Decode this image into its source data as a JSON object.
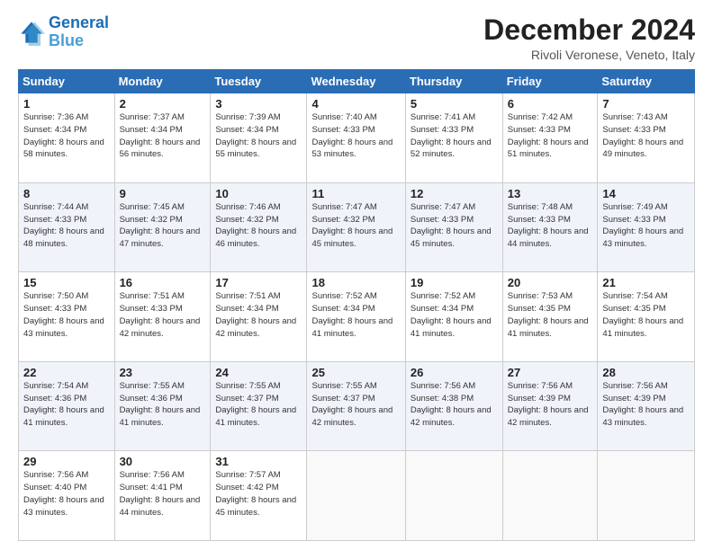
{
  "header": {
    "logo_line1": "General",
    "logo_line2": "Blue",
    "month": "December 2024",
    "location": "Rivoli Veronese, Veneto, Italy"
  },
  "days_of_week": [
    "Sunday",
    "Monday",
    "Tuesday",
    "Wednesday",
    "Thursday",
    "Friday",
    "Saturday"
  ],
  "weeks": [
    [
      {
        "day": "1",
        "sunrise": "7:36 AM",
        "sunset": "4:34 PM",
        "daylight": "8 hours and 58 minutes."
      },
      {
        "day": "2",
        "sunrise": "7:37 AM",
        "sunset": "4:34 PM",
        "daylight": "8 hours and 56 minutes."
      },
      {
        "day": "3",
        "sunrise": "7:39 AM",
        "sunset": "4:34 PM",
        "daylight": "8 hours and 55 minutes."
      },
      {
        "day": "4",
        "sunrise": "7:40 AM",
        "sunset": "4:33 PM",
        "daylight": "8 hours and 53 minutes."
      },
      {
        "day": "5",
        "sunrise": "7:41 AM",
        "sunset": "4:33 PM",
        "daylight": "8 hours and 52 minutes."
      },
      {
        "day": "6",
        "sunrise": "7:42 AM",
        "sunset": "4:33 PM",
        "daylight": "8 hours and 51 minutes."
      },
      {
        "day": "7",
        "sunrise": "7:43 AM",
        "sunset": "4:33 PM",
        "daylight": "8 hours and 49 minutes."
      }
    ],
    [
      {
        "day": "8",
        "sunrise": "7:44 AM",
        "sunset": "4:33 PM",
        "daylight": "8 hours and 48 minutes."
      },
      {
        "day": "9",
        "sunrise": "7:45 AM",
        "sunset": "4:32 PM",
        "daylight": "8 hours and 47 minutes."
      },
      {
        "day": "10",
        "sunrise": "7:46 AM",
        "sunset": "4:32 PM",
        "daylight": "8 hours and 46 minutes."
      },
      {
        "day": "11",
        "sunrise": "7:47 AM",
        "sunset": "4:32 PM",
        "daylight": "8 hours and 45 minutes."
      },
      {
        "day": "12",
        "sunrise": "7:47 AM",
        "sunset": "4:33 PM",
        "daylight": "8 hours and 45 minutes."
      },
      {
        "day": "13",
        "sunrise": "7:48 AM",
        "sunset": "4:33 PM",
        "daylight": "8 hours and 44 minutes."
      },
      {
        "day": "14",
        "sunrise": "7:49 AM",
        "sunset": "4:33 PM",
        "daylight": "8 hours and 43 minutes."
      }
    ],
    [
      {
        "day": "15",
        "sunrise": "7:50 AM",
        "sunset": "4:33 PM",
        "daylight": "8 hours and 43 minutes."
      },
      {
        "day": "16",
        "sunrise": "7:51 AM",
        "sunset": "4:33 PM",
        "daylight": "8 hours and 42 minutes."
      },
      {
        "day": "17",
        "sunrise": "7:51 AM",
        "sunset": "4:34 PM",
        "daylight": "8 hours and 42 minutes."
      },
      {
        "day": "18",
        "sunrise": "7:52 AM",
        "sunset": "4:34 PM",
        "daylight": "8 hours and 41 minutes."
      },
      {
        "day": "19",
        "sunrise": "7:52 AM",
        "sunset": "4:34 PM",
        "daylight": "8 hours and 41 minutes."
      },
      {
        "day": "20",
        "sunrise": "7:53 AM",
        "sunset": "4:35 PM",
        "daylight": "8 hours and 41 minutes."
      },
      {
        "day": "21",
        "sunrise": "7:54 AM",
        "sunset": "4:35 PM",
        "daylight": "8 hours and 41 minutes."
      }
    ],
    [
      {
        "day": "22",
        "sunrise": "7:54 AM",
        "sunset": "4:36 PM",
        "daylight": "8 hours and 41 minutes."
      },
      {
        "day": "23",
        "sunrise": "7:55 AM",
        "sunset": "4:36 PM",
        "daylight": "8 hours and 41 minutes."
      },
      {
        "day": "24",
        "sunrise": "7:55 AM",
        "sunset": "4:37 PM",
        "daylight": "8 hours and 41 minutes."
      },
      {
        "day": "25",
        "sunrise": "7:55 AM",
        "sunset": "4:37 PM",
        "daylight": "8 hours and 42 minutes."
      },
      {
        "day": "26",
        "sunrise": "7:56 AM",
        "sunset": "4:38 PM",
        "daylight": "8 hours and 42 minutes."
      },
      {
        "day": "27",
        "sunrise": "7:56 AM",
        "sunset": "4:39 PM",
        "daylight": "8 hours and 42 minutes."
      },
      {
        "day": "28",
        "sunrise": "7:56 AM",
        "sunset": "4:39 PM",
        "daylight": "8 hours and 43 minutes."
      }
    ],
    [
      {
        "day": "29",
        "sunrise": "7:56 AM",
        "sunset": "4:40 PM",
        "daylight": "8 hours and 43 minutes."
      },
      {
        "day": "30",
        "sunrise": "7:56 AM",
        "sunset": "4:41 PM",
        "daylight": "8 hours and 44 minutes."
      },
      {
        "day": "31",
        "sunrise": "7:57 AM",
        "sunset": "4:42 PM",
        "daylight": "8 hours and 45 minutes."
      },
      null,
      null,
      null,
      null
    ]
  ],
  "labels": {
    "sunrise": "Sunrise:",
    "sunset": "Sunset:",
    "daylight": "Daylight:"
  }
}
